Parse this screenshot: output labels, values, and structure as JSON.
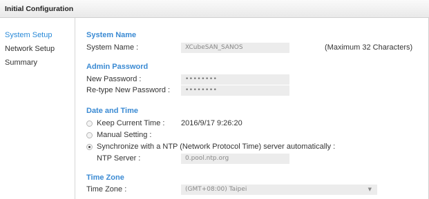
{
  "header": {
    "title": "Initial Configuration"
  },
  "sidebar": {
    "items": [
      {
        "label": "System Setup",
        "active": true
      },
      {
        "label": "Network Setup",
        "active": false
      },
      {
        "label": "Summary",
        "active": false
      }
    ]
  },
  "system_name": {
    "section_title": "System Name",
    "label": "System Name :",
    "value": "XCubeSAN_SANOS",
    "note": "(Maximum 32 Characters)"
  },
  "admin_password": {
    "section_title": "Admin Password",
    "new_label": "New Password :",
    "new_value": "••••••••",
    "retype_label": "Re-type New Password :",
    "retype_value": "••••••••"
  },
  "date_time": {
    "section_title": "Date and Time",
    "keep_current_label": "Keep Current Time :",
    "keep_current_value": "2016/9/17 9:26:20",
    "manual_label": "Manual Setting :",
    "ntp_label": "Synchronize with a NTP (Network Protocol Time) server automatically :",
    "selected_option": "ntp",
    "ntp_server_label": "NTP Server :",
    "ntp_server_value": "0.pool.ntp.org"
  },
  "time_zone": {
    "section_title": "Time Zone",
    "label": "Time Zone :",
    "selected": "(GMT+08:00) Taipei",
    "arrow": "▼"
  }
}
